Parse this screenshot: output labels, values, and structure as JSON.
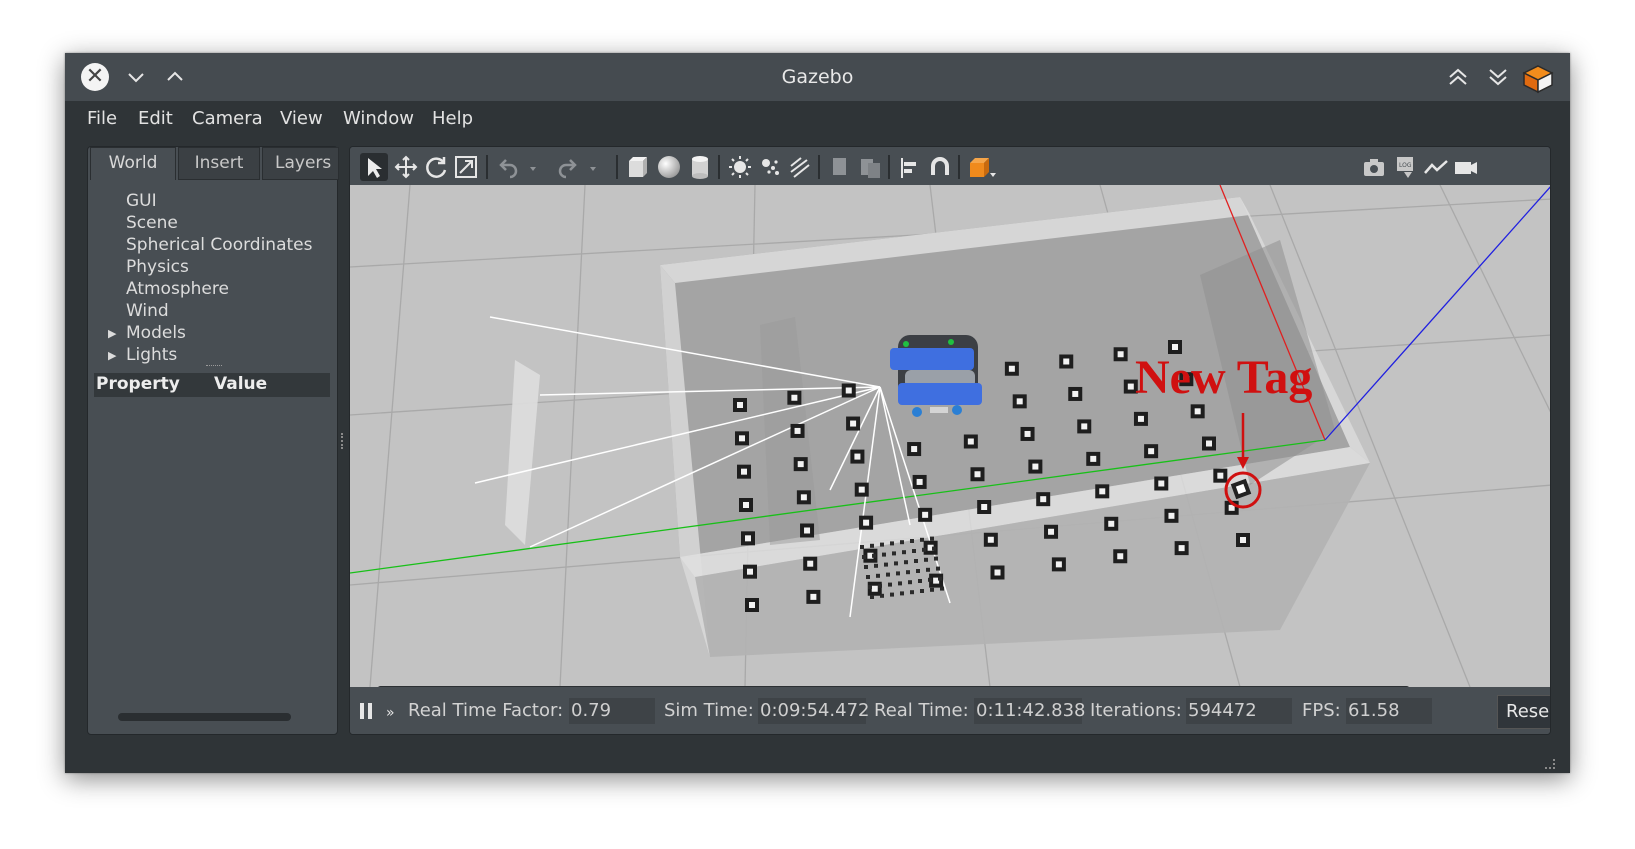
{
  "window": {
    "title": "Gazebo"
  },
  "menu": [
    "File",
    "Edit",
    "Camera",
    "View",
    "Window",
    "Help"
  ],
  "left_panel": {
    "tabs": [
      "World",
      "Insert",
      "Layers"
    ],
    "active_tab": "World",
    "tree": [
      {
        "label": "GUI",
        "expandable": false
      },
      {
        "label": "Scene",
        "expandable": false
      },
      {
        "label": "Spherical Coordinates",
        "expandable": false
      },
      {
        "label": "Physics",
        "expandable": false
      },
      {
        "label": "Atmosphere",
        "expandable": false
      },
      {
        "label": "Wind",
        "expandable": false
      },
      {
        "label": "Models",
        "expandable": true
      },
      {
        "label": "Lights",
        "expandable": true
      }
    ],
    "property_header": {
      "property": "Property",
      "value": "Value"
    }
  },
  "toolbar": {
    "icons": [
      "select-arrow-icon",
      "translate-icon",
      "rotate-icon",
      "scale-icon",
      "undo-icon",
      "redo-icon",
      "box-icon",
      "sphere-icon",
      "cylinder-icon",
      "point-light-icon",
      "spot-light-icon",
      "directional-light-icon",
      "copy-icon",
      "paste-icon",
      "align-icon",
      "snap-icon",
      "view-angle-icon",
      "screenshot-icon",
      "log-icon",
      "plot-icon",
      "record-video-icon"
    ]
  },
  "scene": {
    "annotation": "New Tag",
    "annotation_color": "#d01010"
  },
  "status": {
    "real_time_factor_label": "Real Time Factor:",
    "real_time_factor": "0.79",
    "sim_time_label": "Sim Time:",
    "sim_time": "0:09:54.472",
    "real_time_label": "Real Time:",
    "real_time": "0:11:42.838",
    "iterations_label": "Iterations:",
    "iterations": "594472",
    "fps_label": "FPS:",
    "fps": "61.58",
    "reset_label": "Rese"
  }
}
